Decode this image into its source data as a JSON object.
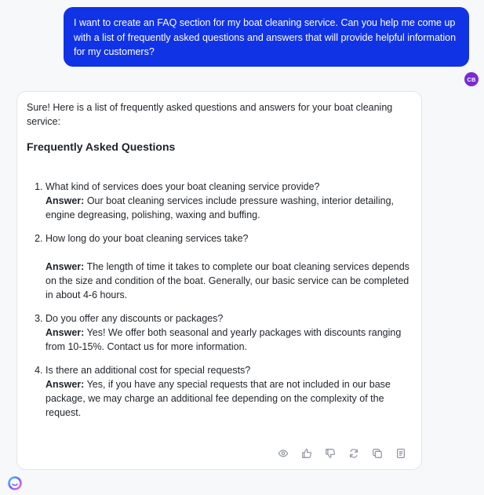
{
  "user_message": {
    "text": "I want to create an FAQ section for my boat cleaning service. Can you help me come up with a list of frequently asked questions and answers that will provide helpful information for my customers?",
    "avatar_initials": "CB",
    "avatar_color": "#7a2bd4",
    "bubble_color": "#1033e6"
  },
  "assistant_message": {
    "intro": "Sure! Here is a list of frequently asked questions and answers for your boat cleaning service:",
    "heading": "Frequently Asked Questions",
    "answer_label": "Answer:",
    "faqs": [
      {
        "question": "What kind of services does your boat cleaning service provide?",
        "answer": "Our boat cleaning services include pressure washing, interior detailing, engine degreasing, polishing, waxing and buffing."
      },
      {
        "question": "How long do your boat cleaning services take?",
        "answer": "The length of time it takes to complete our boat cleaning services depends on the size and condition of the boat. Generally, our basic service can be completed in about 4-6 hours."
      },
      {
        "question": "Do you offer any discounts or packages?",
        "answer": "Yes! We offer both seasonal and yearly packages with discounts ranging from 10-15%. Contact us for more information."
      },
      {
        "question": "Is there an additional cost for special requests?",
        "answer": "Yes, if you have any special requests that are not included in our base package, we may charge an additional fee depending on the complexity of the request."
      }
    ],
    "action_icons": [
      "eye-icon",
      "thumbs-up-icon",
      "thumbs-down-icon",
      "refresh-icon",
      "copy-icon",
      "document-icon"
    ]
  }
}
